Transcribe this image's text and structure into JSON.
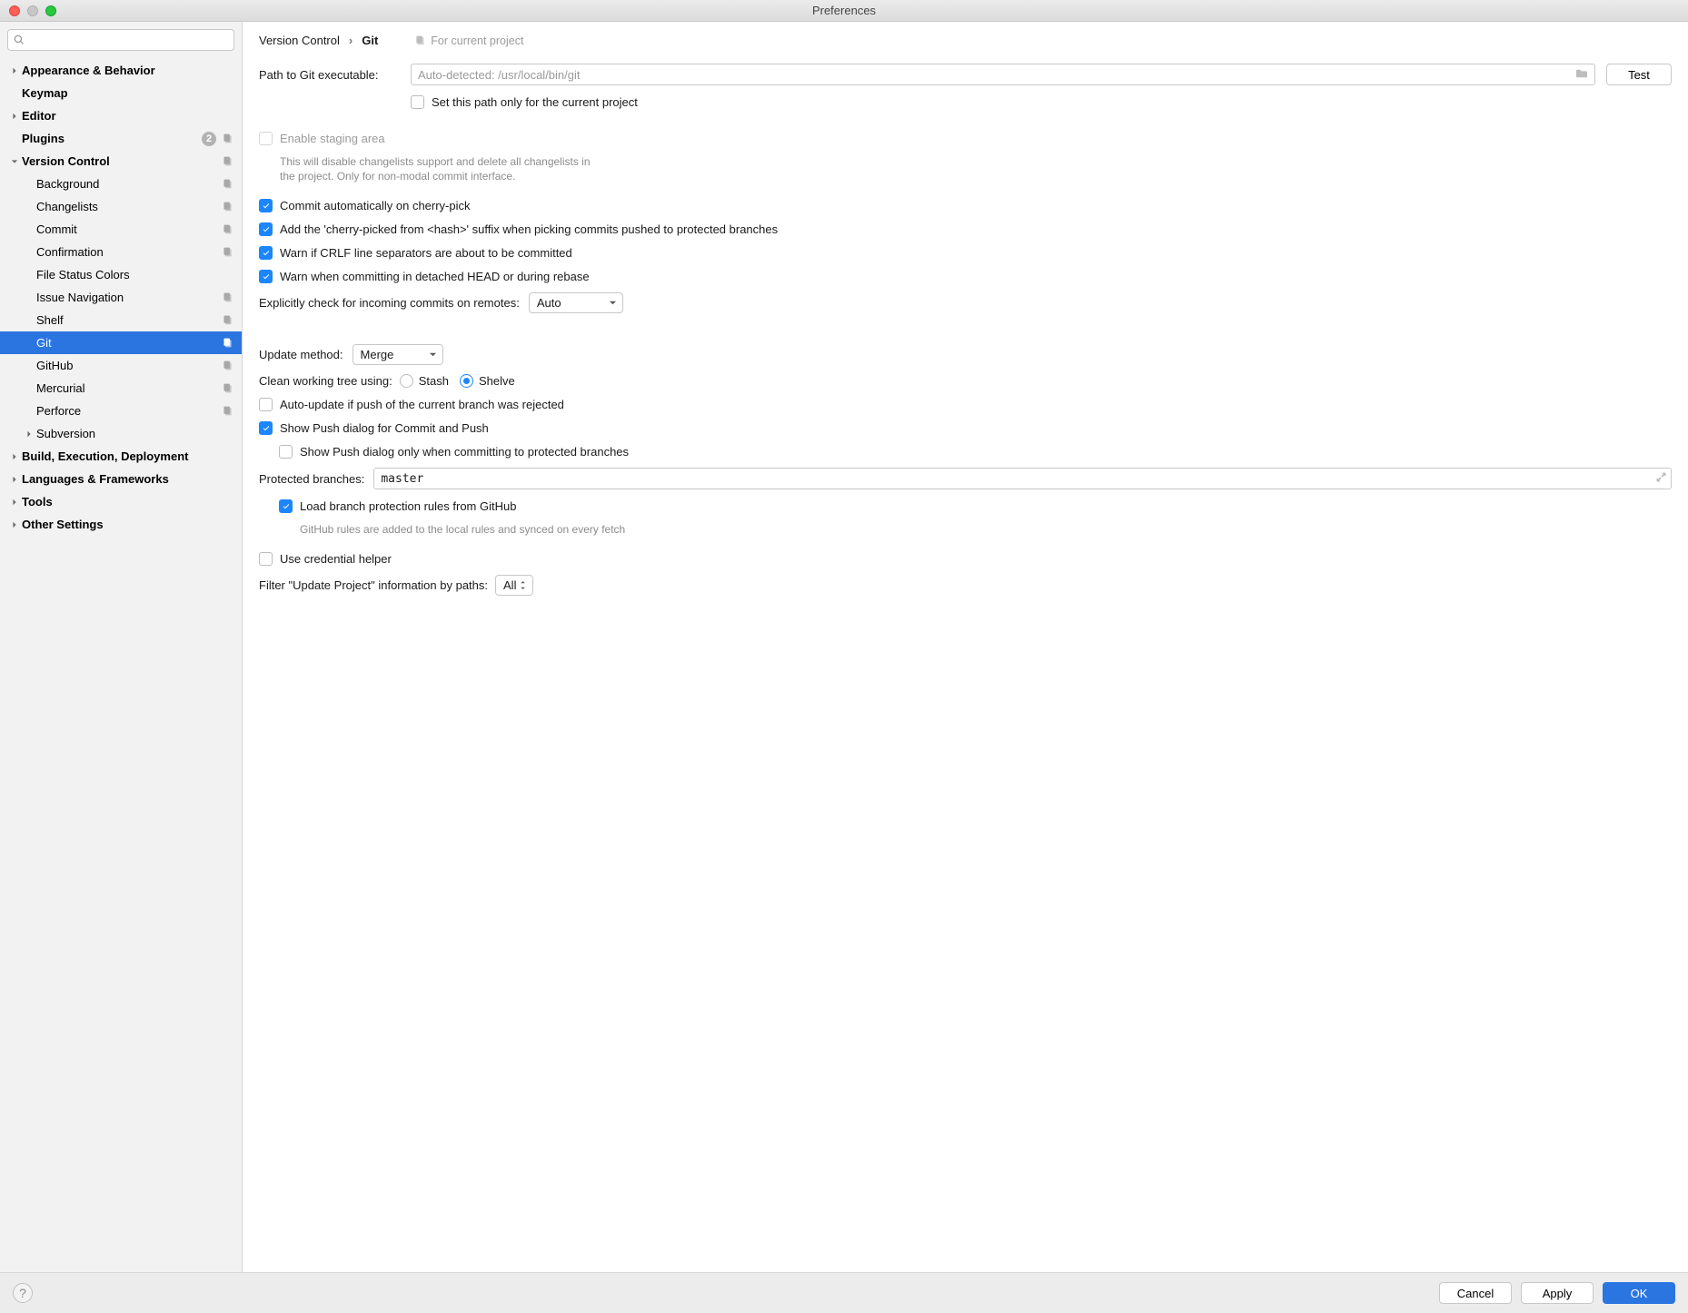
{
  "window": {
    "title": "Preferences"
  },
  "sidebar": {
    "search_placeholder": "",
    "items": [
      {
        "label": "Appearance & Behavior",
        "bold": true,
        "expandable": true,
        "expanded": false,
        "indent": 0
      },
      {
        "label": "Keymap",
        "bold": true,
        "indent": 0
      },
      {
        "label": "Editor",
        "bold": true,
        "expandable": true,
        "expanded": false,
        "indent": 0
      },
      {
        "label": "Plugins",
        "bold": true,
        "indent": 0,
        "badge": "2",
        "scope": true
      },
      {
        "label": "Version Control",
        "bold": true,
        "expandable": true,
        "expanded": true,
        "indent": 0,
        "scope": true
      },
      {
        "label": "Background",
        "indent": 1,
        "scope": true
      },
      {
        "label": "Changelists",
        "indent": 1,
        "scope": true
      },
      {
        "label": "Commit",
        "indent": 1,
        "scope": true
      },
      {
        "label": "Confirmation",
        "indent": 1,
        "scope": true
      },
      {
        "label": "File Status Colors",
        "indent": 1
      },
      {
        "label": "Issue Navigation",
        "indent": 1,
        "scope": true
      },
      {
        "label": "Shelf",
        "indent": 1,
        "scope": true
      },
      {
        "label": "Git",
        "indent": 1,
        "scope": true,
        "selected": true
      },
      {
        "label": "GitHub",
        "indent": 1,
        "scope": true
      },
      {
        "label": "Mercurial",
        "indent": 1,
        "scope": true
      },
      {
        "label": "Perforce",
        "indent": 1,
        "scope": true
      },
      {
        "label": "Subversion",
        "indent": 1,
        "expandable": true,
        "expanded": false
      },
      {
        "label": "Build, Execution, Deployment",
        "bold": true,
        "expandable": true,
        "expanded": false,
        "indent": 0
      },
      {
        "label": "Languages & Frameworks",
        "bold": true,
        "expandable": true,
        "expanded": false,
        "indent": 0
      },
      {
        "label": "Tools",
        "bold": true,
        "expandable": true,
        "expanded": false,
        "indent": 0
      },
      {
        "label": "Other Settings",
        "bold": true,
        "expandable": true,
        "expanded": false,
        "indent": 0
      }
    ]
  },
  "breadcrumb": {
    "a": "Version Control",
    "b": "Git",
    "scope": "For current project"
  },
  "git": {
    "path_label": "Path to Git executable:",
    "path_placeholder": "Auto-detected: /usr/local/bin/git",
    "test": "Test",
    "set_path_project": "Set this path only for the current project",
    "enable_staging": "Enable staging area",
    "enable_staging_note": "This will disable changelists support and delete all changelists in\nthe project. Only for non-modal commit interface.",
    "commit_cherry": "Commit automatically on cherry-pick",
    "cherry_suffix": "Add the 'cherry-picked from <hash>' suffix when picking commits pushed to protected branches",
    "warn_crlf": "Warn if CRLF line separators are about to be committed",
    "warn_detached": "Warn when committing in detached HEAD or during rebase",
    "remote_check_label": "Explicitly check for incoming commits on remotes:",
    "remote_check_value": "Auto",
    "update_method_label": "Update method:",
    "update_method_value": "Merge",
    "clean_label": "Clean working tree using:",
    "clean_stash": "Stash",
    "clean_shelve": "Shelve",
    "auto_update": "Auto-update if push of the current branch was rejected",
    "show_push": "Show Push dialog for Commit and Push",
    "show_push_protected": "Show Push dialog only when committing to protected branches",
    "protected_label": "Protected branches:",
    "protected_value": "master",
    "load_rules": "Load branch protection rules from GitHub",
    "load_rules_note": "GitHub rules are added to the local rules and synced on every fetch",
    "cred_helper": "Use credential helper",
    "filter_label": "Filter \"Update Project\" information by paths:",
    "filter_value": "All"
  },
  "footer": {
    "cancel": "Cancel",
    "apply": "Apply",
    "ok": "OK"
  }
}
